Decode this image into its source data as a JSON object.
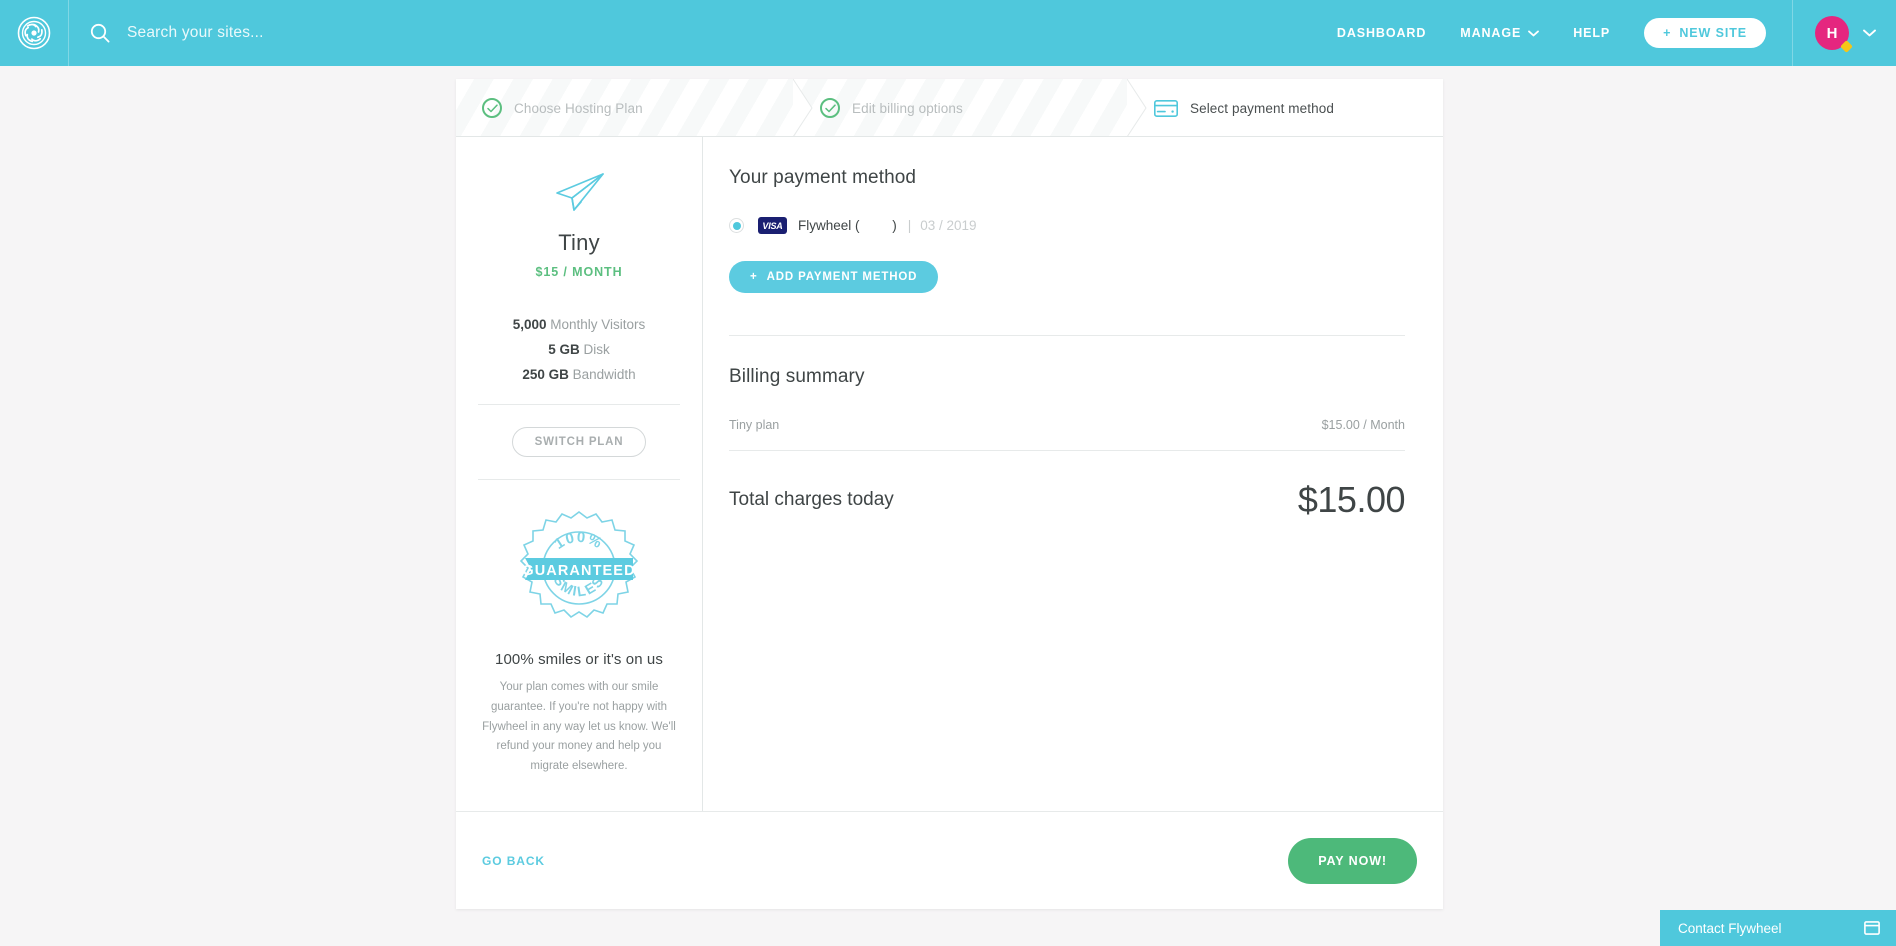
{
  "topnav": {
    "logo": "flywheel-logo",
    "search": {
      "placeholder": "Search your sites...",
      "value": ""
    },
    "links": [
      {
        "label": "DASHBOARD",
        "name": "dashboard"
      },
      {
        "label": "MANAGE",
        "name": "manage",
        "has_caret": true
      },
      {
        "label": "HELP",
        "name": "help"
      }
    ],
    "new_site_label": "NEW SITE",
    "new_site_plus": "+",
    "avatar_initial": "H"
  },
  "steps": [
    {
      "label": "Choose Hosting Plan",
      "state": "done",
      "icon": "check-icon"
    },
    {
      "label": "Edit billing options",
      "state": "done",
      "icon": "check-icon"
    },
    {
      "label": "Select payment method",
      "state": "current",
      "icon": "credit-card-icon"
    }
  ],
  "plan": {
    "icon": "paper-plane-icon",
    "name": "Tiny",
    "price": "$15 / MONTH",
    "specs": [
      {
        "value": "5,000",
        "label": "Monthly Visitors"
      },
      {
        "value": "5 GB",
        "label": "Disk"
      },
      {
        "value": "250 GB",
        "label": "Bandwidth"
      }
    ],
    "switch_plan_label": "SWITCH PLAN"
  },
  "guarantee": {
    "badge_top": "100%",
    "badge_banner": "GUARANTEED",
    "badge_bottom": "SMILES",
    "title": "100% smiles or it's on us",
    "text": "Your plan comes with our smile guarantee. If you're not happy with Flywheel in any way let us know. We'll refund your money and help you migrate elsewhere."
  },
  "payment": {
    "heading": "Your payment method",
    "method": {
      "brand": "VISA",
      "name": "Flywheel (         )",
      "separator": "|",
      "expiry": "03 / 2019",
      "selected": true
    },
    "add_label": "ADD PAYMENT METHOD",
    "add_plus": "+"
  },
  "billing": {
    "heading": "Billing summary",
    "items": [
      {
        "label": "Tiny plan",
        "value": "$15.00 / Month"
      }
    ],
    "total_label": "Total charges today",
    "total_value": "$15.00"
  },
  "footer": {
    "back_label": "GO BACK",
    "pay_label": "PAY NOW!"
  },
  "chat": {
    "label": "Contact Flywheel",
    "icon": "window-icon"
  },
  "colors": {
    "brand_teal": "#4fc8dc",
    "accent_green": "#5cbf80",
    "pay_green": "#4db97a",
    "avatar_pink": "#e5267f",
    "page_bg": "#f6f5f6",
    "badge_yellow": "#f5c518"
  }
}
